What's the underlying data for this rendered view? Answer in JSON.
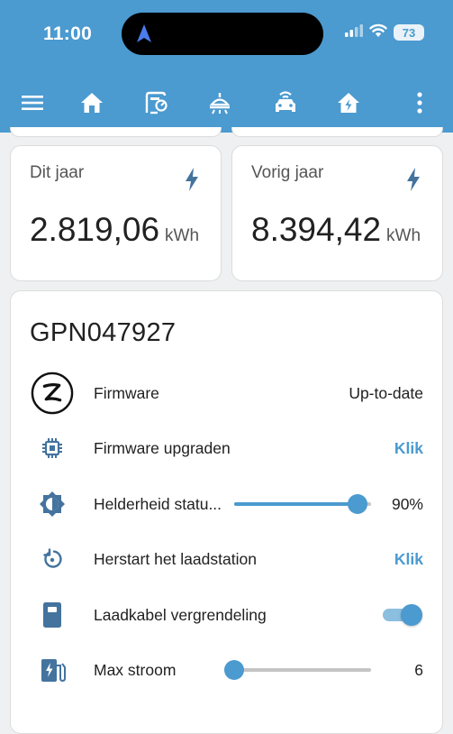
{
  "status_bar": {
    "time": "11:00",
    "battery": "73"
  },
  "toolbar": {
    "icons": [
      "menu-icon",
      "home-icon",
      "energy-meter-icon",
      "light-fixture-icon",
      "car-icon",
      "home-lightning-icon",
      "more-vert-icon"
    ],
    "active_tab": "car-icon"
  },
  "stats": [
    {
      "name": "Dit jaar",
      "value": "2.819,06",
      "unit": "kWh",
      "icon": "lightning-icon"
    },
    {
      "name": "Vorig jaar",
      "value": "8.394,42",
      "unit": "kWh",
      "icon": "lightning-icon"
    }
  ],
  "device": {
    "title": "GPN047927",
    "rows": [
      {
        "label": "Firmware",
        "value": "Up-to-date",
        "icon": "zaptec-logo-icon"
      },
      {
        "label": "Firmware upgraden",
        "action": "Klik",
        "icon": "chip-icon"
      },
      {
        "label": "Helderheid statu...",
        "value": "90%",
        "level_percent": 90,
        "icon": "brightness-icon"
      },
      {
        "label": "Herstart het laadstation",
        "action": "Klik",
        "icon": "restart-icon"
      },
      {
        "label": "Laadkabel vergrendeling",
        "toggle_on": true,
        "icon": "ev-station-icon"
      },
      {
        "label": "Max stroom",
        "value": "6",
        "level_percent": 0,
        "icon": "ev-plug-icon"
      }
    ]
  },
  "colors": {
    "accent": "#4b9ad0",
    "icon": "#44739e",
    "background": "#eef0f2"
  }
}
